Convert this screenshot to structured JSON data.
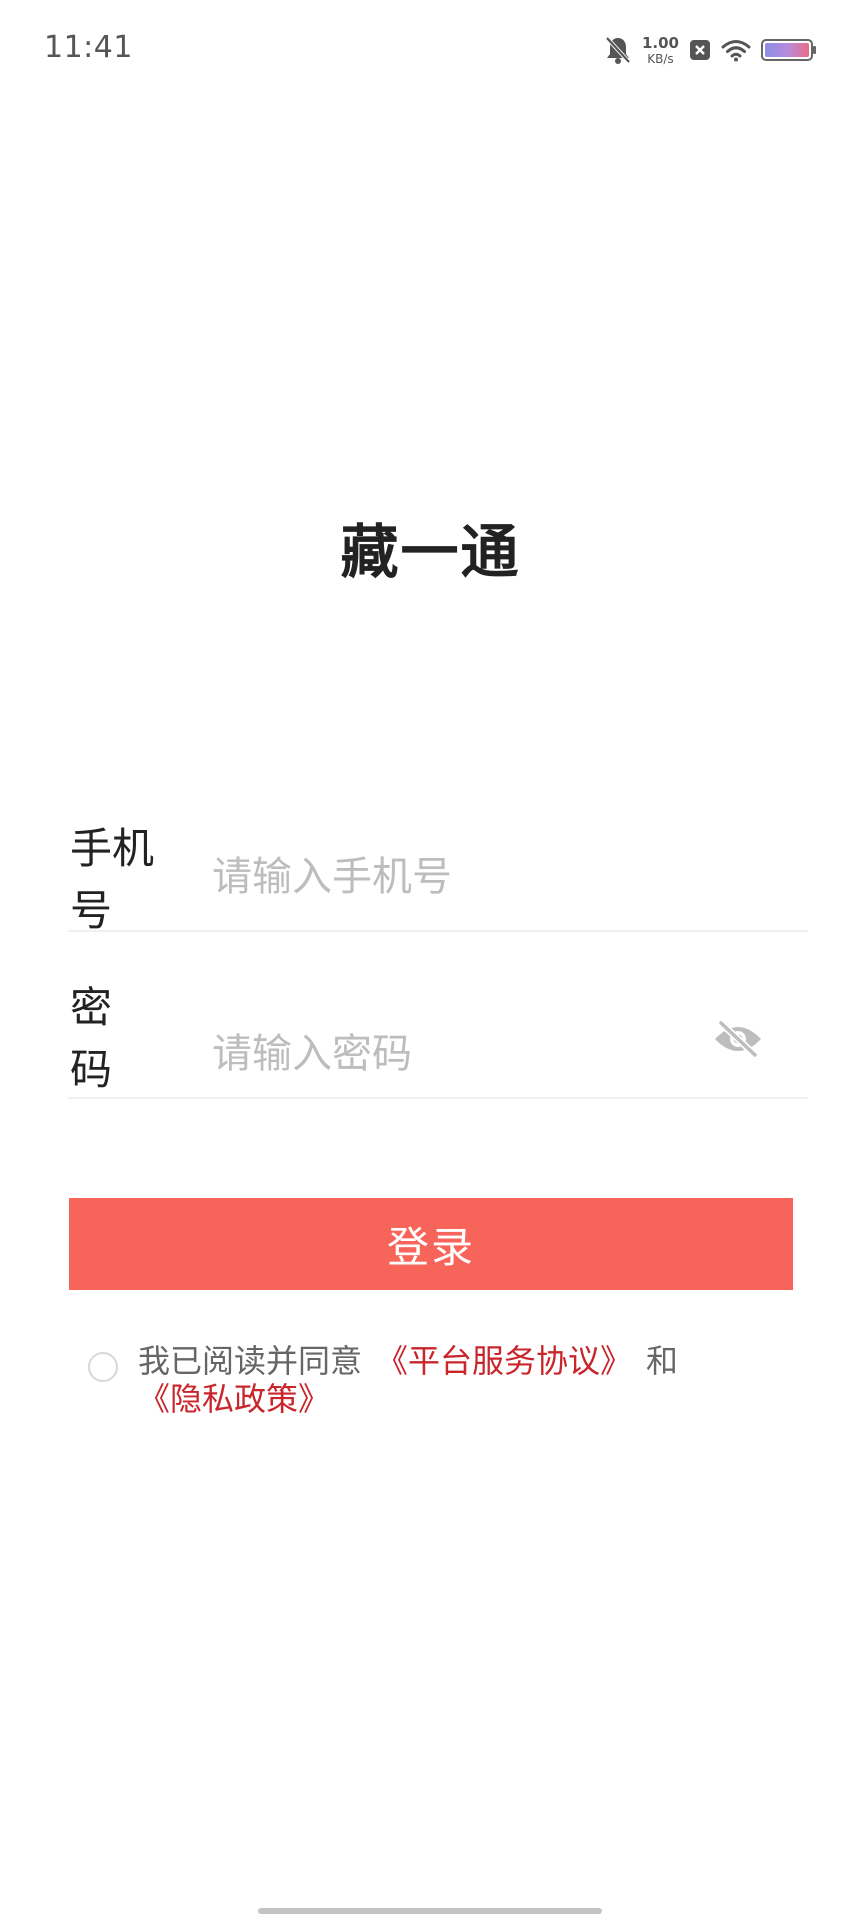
{
  "status_bar": {
    "time": "11:41",
    "net_speed_value": "1.00",
    "net_speed_unit": "KB/s",
    "icons": [
      "bell-muted-icon",
      "close-box-icon",
      "wifi-icon",
      "battery-icon"
    ]
  },
  "app": {
    "title": "藏一通"
  },
  "form": {
    "phone": {
      "label": "手机号",
      "placeholder": "请输入手机号",
      "value": ""
    },
    "password": {
      "label": "密码",
      "placeholder": "请输入密码",
      "value": "",
      "toggle_icon": "eye-off-icon"
    }
  },
  "login_button": {
    "label": "登录"
  },
  "agreement": {
    "checked": false,
    "prefix": "我已阅读并同意",
    "terms_link": "《平台服务协议》",
    "conjunction": "和",
    "privacy_link": "《隐私政策》"
  },
  "colors": {
    "accent": "#f76459",
    "link": "#c8262b",
    "placeholder": "#bdbdbd"
  }
}
